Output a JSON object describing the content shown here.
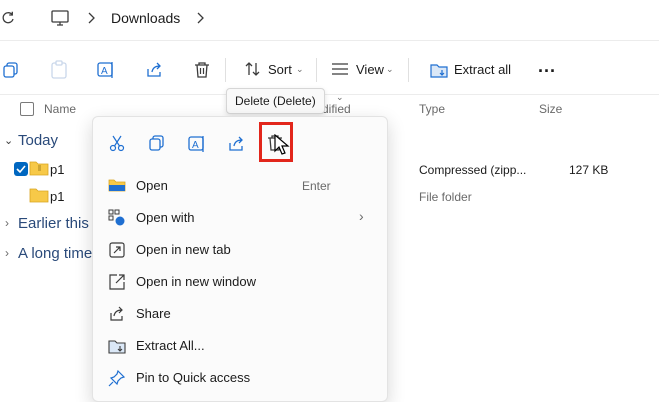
{
  "address": {
    "breadcrumb": [
      "Downloads"
    ]
  },
  "toolbar": {
    "sort_label": "Sort",
    "view_label": "View",
    "extract_all_label": "Extract all",
    "more_label": "..."
  },
  "columns": {
    "name": "Name",
    "date_modified_partial": "dified",
    "type": "Type",
    "size": "Size"
  },
  "tooltip": "Delete (Delete)",
  "groups": [
    {
      "label": "Today"
    },
    {
      "label": "Earlier this "
    },
    {
      "label": "A long time"
    }
  ],
  "files": [
    {
      "name": "p1",
      "type": "Compressed (zipp...",
      "size": "127 KB",
      "checked": true
    },
    {
      "name": "p1",
      "type": "File folder",
      "size": ""
    }
  ],
  "context_menu": {
    "items": [
      {
        "label": "Open",
        "shortcut": "Enter",
        "icon": "folder-open-icon"
      },
      {
        "label": "Open with",
        "shortcut": "",
        "icon": "open-with-icon",
        "submenu": true
      },
      {
        "label": "Open in new tab",
        "shortcut": "",
        "icon": "new-tab-icon"
      },
      {
        "label": "Open in new window",
        "shortcut": "",
        "icon": "new-window-icon"
      },
      {
        "label": "Share",
        "shortcut": "",
        "icon": "share-icon"
      },
      {
        "label": "Extract All...",
        "shortcut": "",
        "icon": "extract-icon"
      },
      {
        "label": "Pin to Quick access",
        "shortcut": "",
        "icon": "pin-icon"
      }
    ]
  },
  "colors": {
    "accent": "#0067c0",
    "highlight_red": "#e2261b",
    "folder_yellow": "#f7c948"
  }
}
